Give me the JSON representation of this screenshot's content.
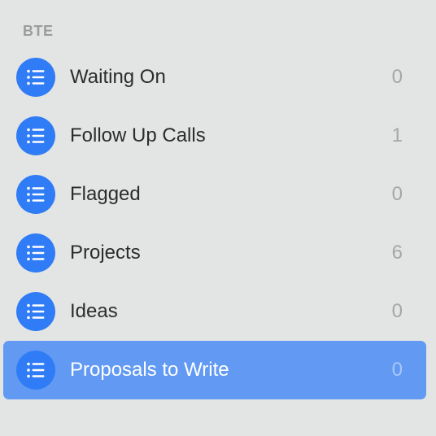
{
  "section": {
    "title": "BTE"
  },
  "lists": [
    {
      "name": "Waiting On",
      "count": "0",
      "icon": "list-bullet-icon",
      "selected": false
    },
    {
      "name": "Follow Up Calls",
      "count": "1",
      "icon": "list-bullet-icon",
      "selected": false
    },
    {
      "name": "Flagged",
      "count": "0",
      "icon": "list-bullet-icon",
      "selected": false
    },
    {
      "name": "Projects",
      "count": "6",
      "icon": "list-bullet-icon",
      "selected": false
    },
    {
      "name": "Ideas",
      "count": "0",
      "icon": "list-bullet-icon",
      "selected": false
    },
    {
      "name": "Proposals to Write",
      "count": "0",
      "icon": "list-bullet-icon",
      "selected": true
    }
  ],
  "colors": {
    "background": "#e3e4e4",
    "icon_blue": "#2f7cf6",
    "selected_row": "#6199f3"
  }
}
